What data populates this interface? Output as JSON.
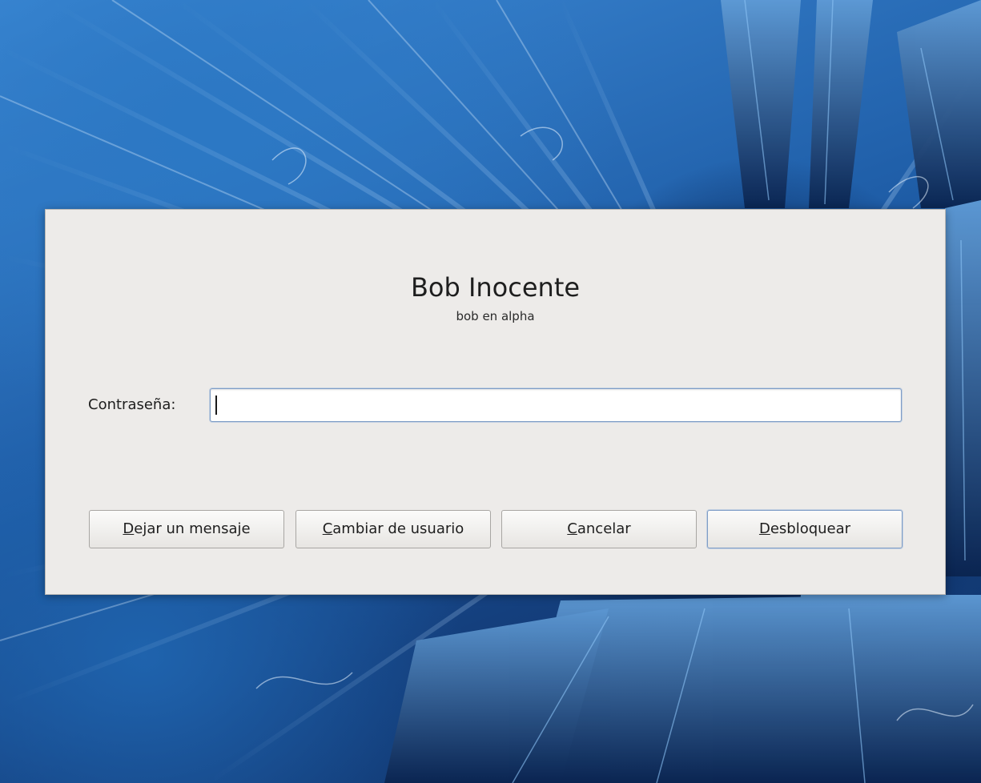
{
  "dialog": {
    "user_name": "Bob Inocente",
    "host_line": "bob en alpha",
    "password_label": "Contraseña:",
    "password_value": ""
  },
  "buttons": {
    "leave_message": {
      "mnemonic": "D",
      "rest": "ejar un mensaje"
    },
    "switch_user": {
      "mnemonic": "C",
      "rest": "ambiar de usuario"
    },
    "cancel": {
      "mnemonic": "C",
      "rest": "ancelar"
    },
    "unlock": {
      "mnemonic": "D",
      "rest": "esbloquear"
    }
  },
  "colors": {
    "dialog_background": "#edebe9",
    "focus_border": "#7f9dc6",
    "wallpaper_primary": "#1f5ea8"
  }
}
